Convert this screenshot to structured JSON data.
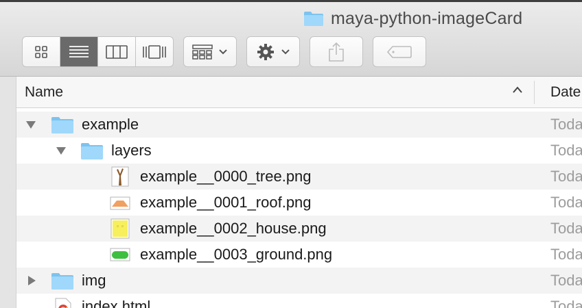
{
  "window": {
    "title": "maya-python-imageCard"
  },
  "toolbar": {
    "view_buttons": [
      "icon-view",
      "list-view",
      "column-view",
      "cover-flow-view"
    ],
    "active_view": "list-view",
    "arrange_icon": "grid-arrange-icon",
    "action_icon": "gear-icon",
    "share_icon": "share-icon",
    "tag_icon": "tag-icon"
  },
  "header": {
    "name_label": "Name",
    "date_label": "Date"
  },
  "rows": [
    {
      "name": "example",
      "date": "Toda",
      "type": "folder",
      "level": 0,
      "disclosure": "expanded"
    },
    {
      "name": "layers",
      "date": "Toda",
      "type": "folder",
      "level": 1,
      "disclosure": "expanded"
    },
    {
      "name": "example__0000_tree.png",
      "date": "Toda",
      "type": "png-tree",
      "level": 2
    },
    {
      "name": "example__0001_roof.png",
      "date": "Toda",
      "type": "png-roof",
      "level": 2
    },
    {
      "name": "example__0002_house.png",
      "date": "Toda",
      "type": "png-house",
      "level": 2
    },
    {
      "name": "example__0003_ground.png",
      "date": "Toda",
      "type": "png-ground",
      "level": 2
    },
    {
      "name": "img",
      "date": "Toda",
      "type": "folder",
      "level": 0,
      "disclosure": "collapsed"
    },
    {
      "name": "index.html",
      "date": "Toda",
      "type": "html-file",
      "level": 0
    }
  ],
  "colors": {
    "folder": "#8fd0f7",
    "folder_tab": "#7cc3ef",
    "active_segment": "#6a6a6a"
  }
}
